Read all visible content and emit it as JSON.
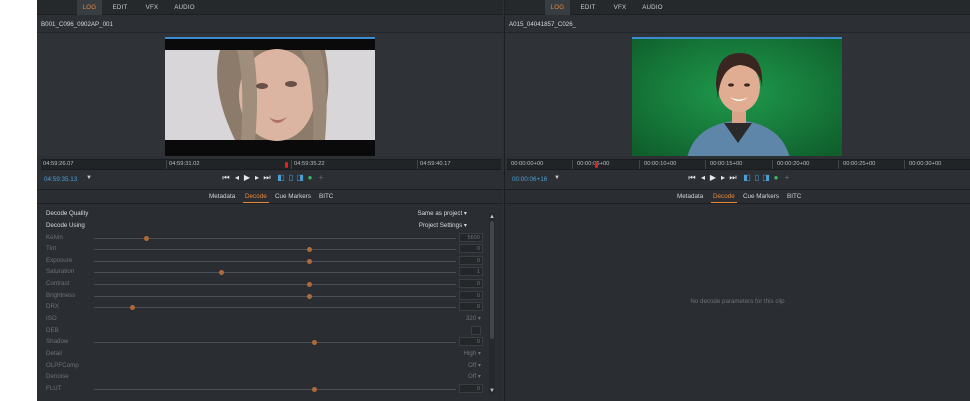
{
  "left": {
    "tabs": [
      "LOG",
      "EDIT",
      "VFX",
      "AUDIO"
    ],
    "clip_name": "B001_C096_0902AP_001",
    "timeline_labels": [
      "04:59:26.07",
      "04:59:31.02",
      "04:59:35.22",
      "04:59:40.17"
    ],
    "current_tc": "04:59:35.13",
    "subtabs": [
      "Metadata",
      "Decode",
      "Cue Markers",
      "BITC"
    ],
    "decode": {
      "quality_label": "Decode Quality",
      "quality_value": "Same as project",
      "using_label": "Decode Using",
      "using_value": "Project Settings",
      "params": [
        {
          "label": "Kelvin",
          "value": "5600",
          "level": 0.04
        },
        {
          "label": "Tint",
          "value": "0",
          "level": 0.5
        },
        {
          "label": "Exposure",
          "value": "0",
          "level": 0.5
        },
        {
          "label": "Saturation",
          "value": "1",
          "level": 0.25
        },
        {
          "label": "Contrast",
          "value": "0",
          "level": 0.5
        },
        {
          "label": "Brightness",
          "value": "0",
          "level": 0.5
        },
        {
          "label": "DRX",
          "value": "0",
          "level": 0.0
        }
      ],
      "iso_label": "ISO",
      "iso_value": "320",
      "def_label": "DEB",
      "shadow": {
        "label": "Shadow",
        "value": "0",
        "level": 0.5
      },
      "detail_label": "Detail",
      "detail_value": "High",
      "olpf_label": "OLPFComp",
      "olpf_value": "Off",
      "denoise_label": "Denoise",
      "denoise_value": "Off",
      "flut": {
        "label": "FLUT",
        "value": "0",
        "level": 0.5
      }
    }
  },
  "right": {
    "tabs": [
      "LOG",
      "EDIT",
      "VFX",
      "AUDIO"
    ],
    "clip_name": "A015_04041857_C026_",
    "timeline_labels": [
      "00:00:00+00",
      "00:00:05+00",
      "00:00:10+00",
      "00:00:15+00",
      "00:00:20+00",
      "00:00:25+00",
      "00:00:30+00"
    ],
    "current_tc": "00:00:06+16",
    "subtabs": [
      "Metadata",
      "Decode",
      "Cue Markers",
      "BITC"
    ],
    "no_decode_message": "No decode parameters for this clip"
  },
  "transport_icons": [
    "go-to-start-icon",
    "step-back-icon",
    "play-icon",
    "step-forward-icon",
    "go-to-end-icon",
    "mark-in-icon",
    "mark-out-icon",
    "loop-icon",
    "audio-icon",
    "add-icon"
  ],
  "colors": {
    "accent": "#e8883a",
    "timecode": "#4c9ed6",
    "playhead": "#e2201f",
    "panel": "#2c3034"
  }
}
